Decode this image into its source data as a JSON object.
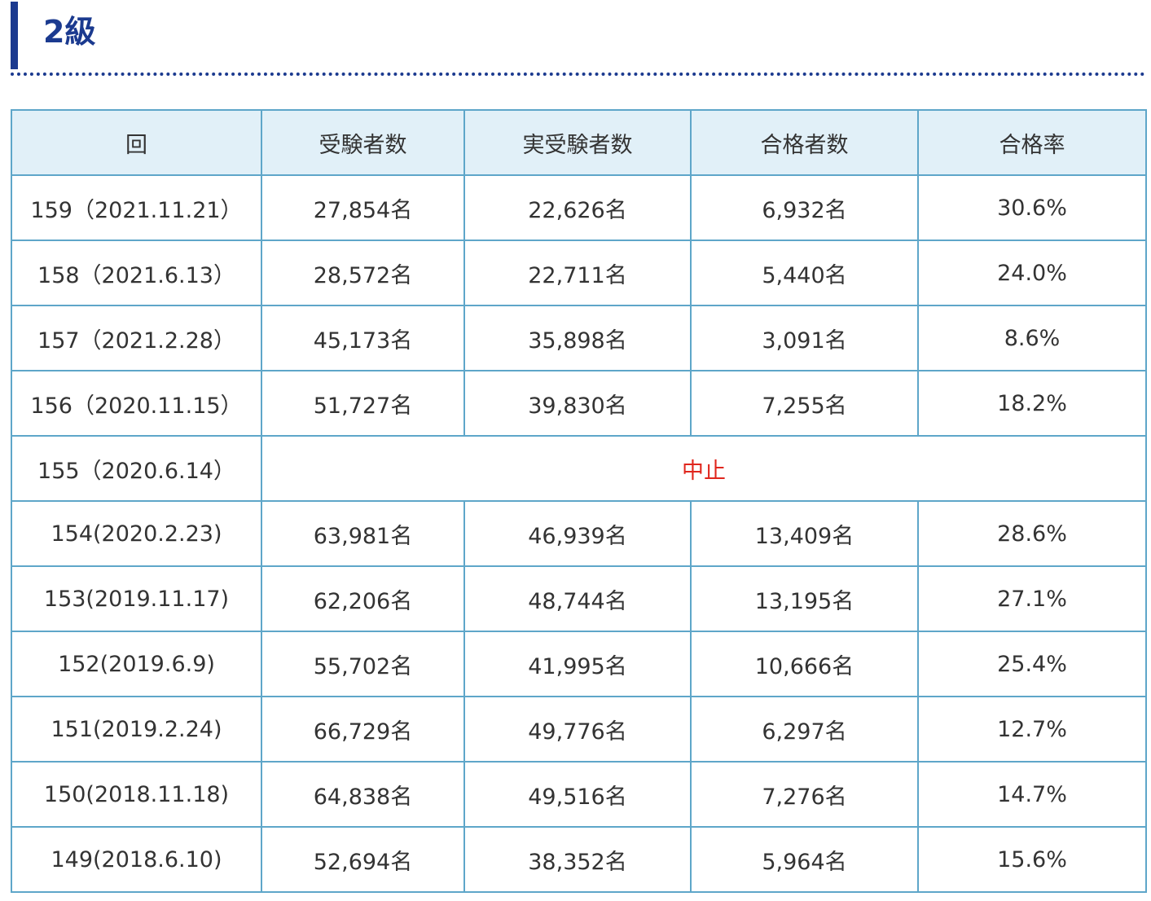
{
  "heading": {
    "title": "2級",
    "accent_color": "#1b3a8f"
  },
  "table": {
    "header_bg": "#e1f0f8",
    "border_color": "#5ea6c9",
    "cancelled_color": "#e0261d",
    "columns": [
      "回",
      "受験者数",
      "実受験者数",
      "合格者数",
      "合格率"
    ],
    "rows": [
      {
        "round": "159（2021.11.21）",
        "applicants": "27,854名",
        "examinees": "22,626名",
        "passed": "6,932名",
        "rate": "30.6%"
      },
      {
        "round": "158（2021.6.13）",
        "applicants": "28,572名",
        "examinees": "22,711名",
        "passed": "5,440名",
        "rate": "24.0%"
      },
      {
        "round": "157（2021.2.28）",
        "applicants": "45,173名",
        "examinees": "35,898名",
        "passed": "3,091名",
        "rate": "8.6%"
      },
      {
        "round": "156（2020.11.15）",
        "applicants": "51,727名",
        "examinees": "39,830名",
        "passed": "7,255名",
        "rate": "18.2%"
      },
      {
        "round": "155（2020.6.14）",
        "cancelled": "中止"
      },
      {
        "round": "154(2020.2.23)",
        "applicants": "63,981名",
        "examinees": "46,939名",
        "passed": "13,409名",
        "rate": "28.6%"
      },
      {
        "round": "153(2019.11.17)",
        "applicants": "62,206名",
        "examinees": "48,744名",
        "passed": "13,195名",
        "rate": "27.1%"
      },
      {
        "round": "152(2019.6.9)",
        "applicants": "55,702名",
        "examinees": "41,995名",
        "passed": "10,666名",
        "rate": "25.4%"
      },
      {
        "round": "151(2019.2.24)",
        "applicants": "66,729名",
        "examinees": "49,776名",
        "passed": "6,297名",
        "rate": "12.7%"
      },
      {
        "round": "150(2018.11.18)",
        "applicants": "64,838名",
        "examinees": "49,516名",
        "passed": "7,276名",
        "rate": "14.7%"
      },
      {
        "round": "149(2018.6.10)",
        "applicants": "52,694名",
        "examinees": "38,352名",
        "passed": "5,964名",
        "rate": "15.6%"
      }
    ]
  }
}
